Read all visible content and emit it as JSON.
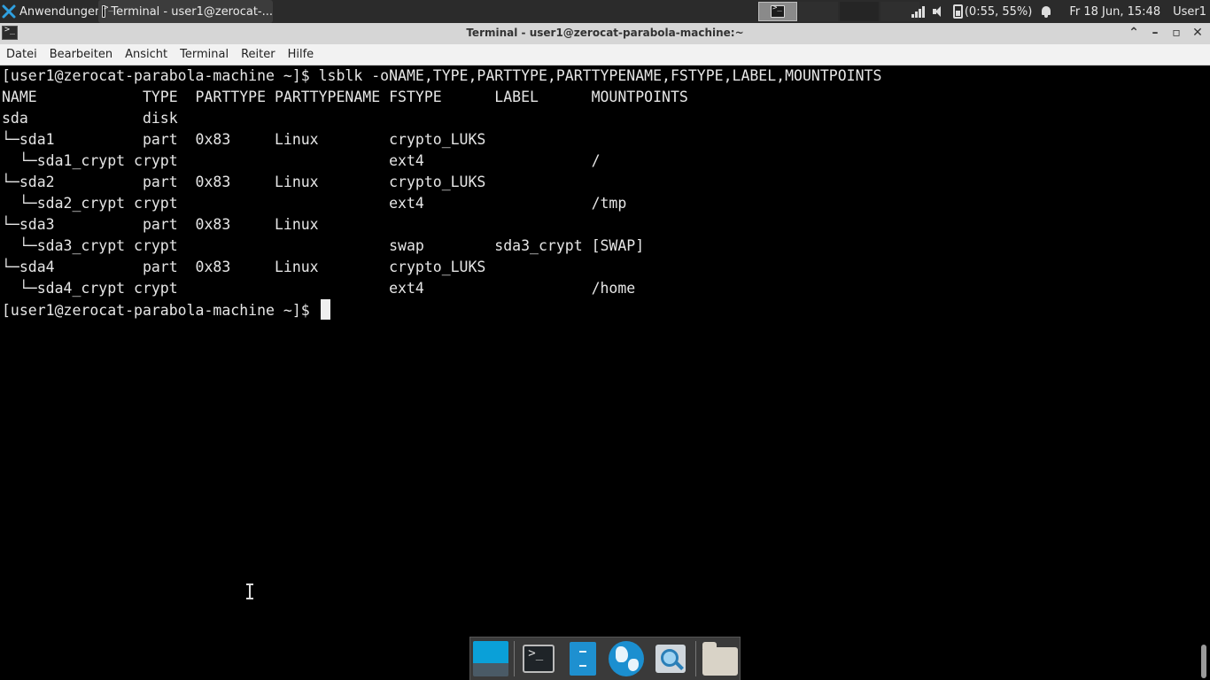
{
  "top_panel": {
    "apps_menu_label": "Anwendungen",
    "task_title": "Terminal - user1@zerocat-...",
    "battery_text": "(0:55, 55%)",
    "clock": "Fr 18 Jun, 15:48",
    "user": "User1"
  },
  "window": {
    "title": "Terminal - user1@zerocat-parabola-machine:~"
  },
  "menubar": {
    "items": [
      "Datei",
      "Bearbeiten",
      "Ansicht",
      "Terminal",
      "Reiter",
      "Hilfe"
    ]
  },
  "terminal": {
    "lines": [
      "[user1@zerocat-parabola-machine ~]$ lsblk -oNAME,TYPE,PARTTYPE,PARTTYPENAME,FSTYPE,LABEL,MOUNTPOINTS",
      "NAME            TYPE  PARTTYPE PARTTYPENAME FSTYPE      LABEL      MOUNTPOINTS",
      "sda             disk",
      "└─sda1          part  0x83     Linux        crypto_LUKS",
      "  └─sda1_crypt crypt                        ext4                   /",
      "└─sda2          part  0x83     Linux        crypto_LUKS",
      "  └─sda2_crypt crypt                        ext4                   /tmp",
      "└─sda3          part  0x83     Linux",
      "  └─sda3_crypt crypt                        swap        sda3_crypt [SWAP]",
      "└─sda4          part  0x83     Linux        crypto_LUKS",
      "  └─sda4_crypt crypt                        ext4                   /home",
      "[user1@zerocat-parabola-machine ~]$ "
    ]
  },
  "icons": {
    "apps_menu": "xfce-mouse-icon",
    "task": "terminal-icon",
    "tray": [
      "signal-icon",
      "speaker-icon",
      "battery-icon",
      "bell-icon"
    ],
    "dock": [
      "show-desktop-icon",
      "terminal-icon",
      "file-cabinet-icon",
      "web-browser-icon",
      "app-finder-icon",
      "folder-icon"
    ]
  },
  "colors": {
    "panel_bg": "#2b2b2b",
    "titlebar_bg": "#d6d6d6",
    "terminal_bg": "#000000",
    "terminal_fg": "#e6e6e6",
    "accent": "#1b8fd0"
  }
}
